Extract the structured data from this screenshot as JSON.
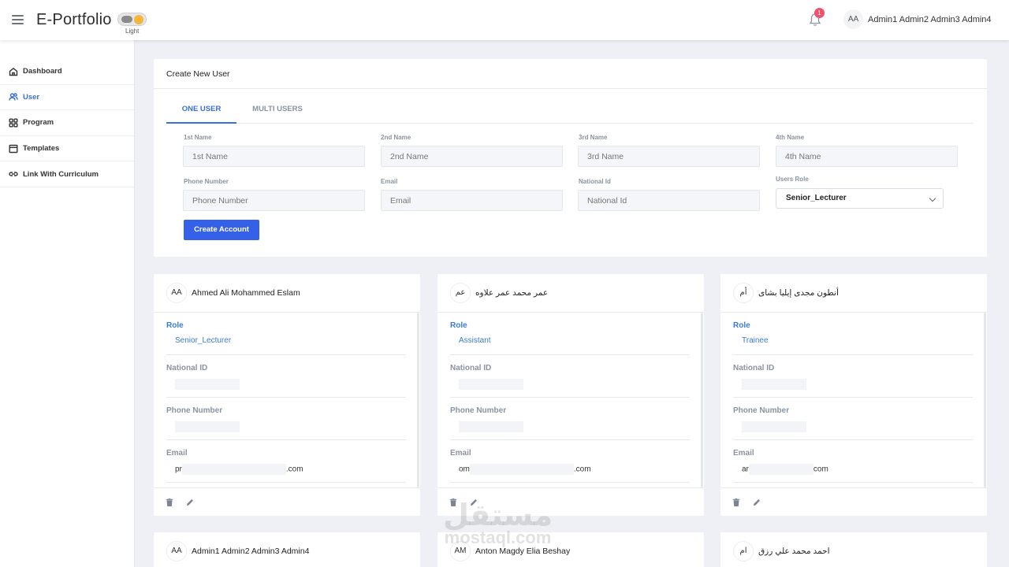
{
  "header": {
    "app_title": "E-Portfolio",
    "theme_label": "Light",
    "notification_count": "1",
    "user_initials": "AA",
    "user_name": "Admin1 Admin2 Admin3 Admin4"
  },
  "sidebar": {
    "items": [
      {
        "label": "Dashboard",
        "icon": "home-icon"
      },
      {
        "label": "User",
        "icon": "users-icon",
        "active": true
      },
      {
        "label": "Program",
        "icon": "grid-icon"
      },
      {
        "label": "Templates",
        "icon": "template-icon"
      },
      {
        "label": "Link With Curriculum",
        "icon": "link-icon"
      }
    ]
  },
  "create_user": {
    "title": "Create New User",
    "tabs": [
      "ONE USER",
      "MULTI USERS"
    ],
    "active_tab": "ONE USER",
    "fields": {
      "first_name": {
        "label": "1st Name",
        "placeholder": "1st Name"
      },
      "second_name": {
        "label": "2nd Name",
        "placeholder": "2nd Name"
      },
      "third_name": {
        "label": "3rd Name",
        "placeholder": "3rd Name"
      },
      "fourth_name": {
        "label": "4th Name",
        "placeholder": "4th Name"
      },
      "phone": {
        "label": "Phone Number",
        "placeholder": "Phone Number"
      },
      "email": {
        "label": "Email",
        "placeholder": "Email"
      },
      "national_id": {
        "label": "National Id",
        "placeholder": "National Id"
      },
      "role": {
        "label": "Users Role",
        "value": "Senior_Lecturer"
      }
    },
    "submit_label": "Create Account"
  },
  "labels": {
    "role": "Role",
    "national_id": "National ID",
    "phone": "Phone Number",
    "email": "Email"
  },
  "users": [
    {
      "initials": "AA",
      "name": "Ahmed Ali Mohammed Eslam",
      "role": "Senior_Lecturer",
      "email_prefix": "pr",
      "email_suffix": ".com"
    },
    {
      "initials": "عم",
      "name": "عمر محمد عمر علاوه",
      "role": "Assistant",
      "email_prefix": "om",
      "email_suffix": ".com"
    },
    {
      "initials": "أم",
      "name": "أنطون مجدى إيليا بشاى",
      "role": "Trainee",
      "email_prefix": "ar",
      "email_suffix": "com"
    },
    {
      "initials": "AA",
      "name": "Admin1 Admin2 Admin3 Admin4"
    },
    {
      "initials": "AM",
      "name": "Anton Magdy Elia Beshay"
    },
    {
      "initials": "ام",
      "name": "احمد محمد علي رزق"
    }
  ],
  "watermark": {
    "arabic": "مستقل",
    "latin": "mostaql.com"
  },
  "colors": {
    "accent": "#3561e8",
    "role_blue": "#3b7bd6",
    "badge": "#f0506e",
    "background": "#eef0f5"
  }
}
